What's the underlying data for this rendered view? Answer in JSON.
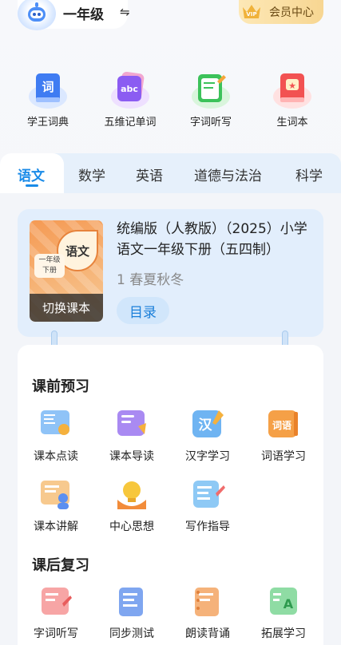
{
  "header": {
    "grade": "一年级",
    "vip_label": "会员中心",
    "vip_badge": "VIP"
  },
  "tools": [
    {
      "label": "学王词典",
      "icon": "dictionary-icon",
      "glyph": "词"
    },
    {
      "label": "五维记单词",
      "icon": "word-card-icon",
      "glyph": "abc"
    },
    {
      "label": "字词听写",
      "icon": "dictation-icon",
      "glyph": ""
    },
    {
      "label": "生词本",
      "icon": "vocab-book-icon",
      "glyph": "★"
    }
  ],
  "tabs": [
    "语文",
    "数学",
    "英语",
    "道德与法治",
    "科学"
  ],
  "book": {
    "title": "统编版（人教版）（2025）小学语文一年级下册（五四制）",
    "terms": "1 春夏秋冬",
    "cover_subject": "语文",
    "cover_grade_line1": "一年级",
    "cover_grade_line2": "下册",
    "switch_label": "切换课本",
    "toc_label": "目录"
  },
  "pre_study": {
    "title": "课前预习",
    "items": [
      {
        "label": "课本点读",
        "icon": "textbook-read-icon"
      },
      {
        "label": "课本导读",
        "icon": "guide-read-icon"
      },
      {
        "label": "汉字学习",
        "icon": "character-learn-icon",
        "glyph": "汉"
      },
      {
        "label": "词语学习",
        "icon": "word-learn-icon",
        "glyph": "词语"
      },
      {
        "label": "课本讲解",
        "icon": "lecture-icon"
      },
      {
        "label": "中心思想",
        "icon": "bulb-icon"
      },
      {
        "label": "写作指导",
        "icon": "writing-guide-icon"
      }
    ]
  },
  "post_review": {
    "title": "课后复习",
    "items": [
      {
        "label": "字词听写",
        "icon": "dictation-review-icon"
      },
      {
        "label": "同步测试",
        "icon": "test-icon"
      },
      {
        "label": "朗读背诵",
        "icon": "recite-icon"
      },
      {
        "label": "拓展学习",
        "icon": "extend-learn-icon",
        "glyph": "A"
      }
    ]
  },
  "colors": {
    "accent": "#1a8be8",
    "vip_gold": "#f7d692"
  }
}
